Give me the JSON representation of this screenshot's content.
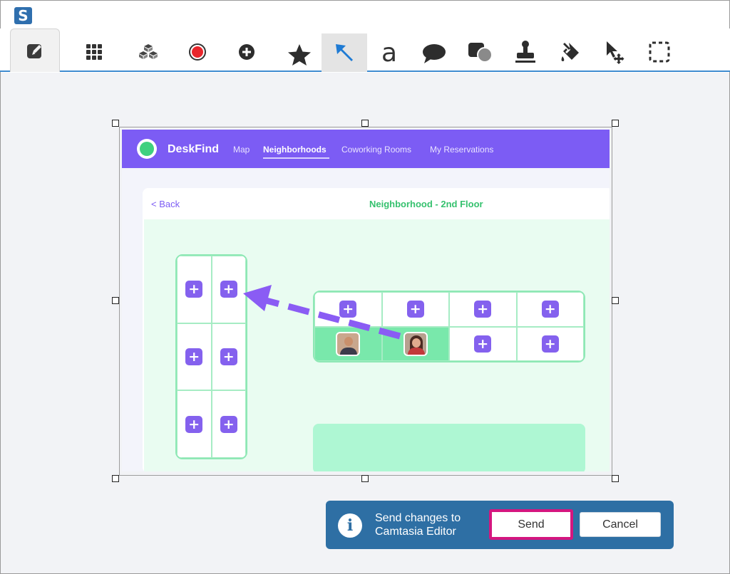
{
  "app": {
    "logo_letter": "S"
  },
  "toolbar": {
    "tools": [
      {
        "name": "edit-tab-icon"
      },
      {
        "name": "grid-icon"
      },
      {
        "name": "cubes-icon"
      },
      {
        "name": "record-icon"
      },
      {
        "name": "add-circle-icon"
      },
      {
        "name": "star-icon"
      },
      {
        "name": "arrow-tool-icon"
      },
      {
        "name": "text-tool-icon",
        "glyph": "a"
      },
      {
        "name": "callout-icon"
      },
      {
        "name": "shapes-icon"
      },
      {
        "name": "stamp-icon"
      },
      {
        "name": "fill-icon"
      },
      {
        "name": "move-cursor-icon"
      },
      {
        "name": "selection-icon"
      }
    ]
  },
  "screenshot": {
    "brand": "DeskFind",
    "nav": [
      "Map",
      "Neighborhoods",
      "Coworking Rooms",
      "My Reservations"
    ],
    "active_nav": "Neighborhoods",
    "back_label": "< Back",
    "panel_title": "Neighborhood - 2nd Floor",
    "left_desks": {
      "cols": 2,
      "rows": 3,
      "plus": "+"
    },
    "right_desks": {
      "cols": 4,
      "rows": 2,
      "plus": "+",
      "taken": [
        4,
        5
      ]
    }
  },
  "colors": {
    "accent": "#7c5cf4",
    "arrow": "#8a5cf4",
    "notify": "#2e6fa4",
    "send_border": "#d4167f"
  },
  "notification": {
    "icon": "i",
    "line1": "Send changes to",
    "line2": "Camtasia Editor",
    "send_label": "Send",
    "cancel_label": "Cancel"
  }
}
